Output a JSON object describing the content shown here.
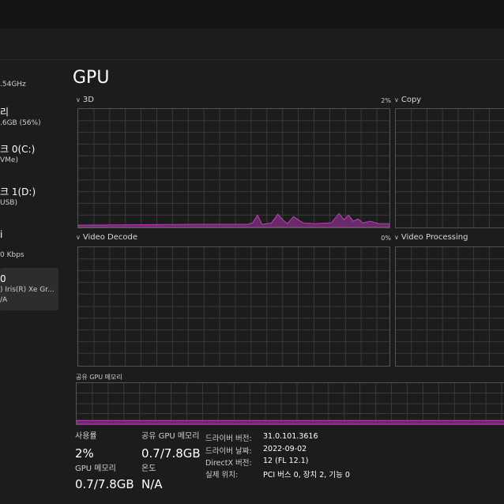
{
  "sidebar": {
    "items": [
      {
        "title": "",
        "sub": ".54GHz"
      },
      {
        "title": "리",
        "sub": ".6GB (56%)"
      },
      {
        "title": "크 0(C:)",
        "sub": "VMe)"
      },
      {
        "title": "크 1(D:)",
        "sub": "USB)"
      },
      {
        "title": "i",
        "sub": "0 Kbps"
      },
      {
        "title": "0",
        "sub": ") Iris(R) Xe Gr...",
        "sub2": "/A"
      }
    ]
  },
  "gpu": {
    "title": "GPU",
    "engines": [
      {
        "label": "3D",
        "percent": "2%"
      },
      {
        "label": "Copy",
        "percent": ""
      },
      {
        "label": "Video Decode",
        "percent": "0%"
      },
      {
        "label": "Video Processing",
        "percent": ""
      }
    ],
    "shared_memory_label": "공유 GPU 메모리",
    "accent_color": "#c040c0",
    "stats": {
      "utilization_label": "사용률",
      "utilization_value": "2%",
      "shared_memory_label": "공유 GPU 메모리",
      "shared_memory_value": "0.7/7.8GB",
      "gpu_memory_label": "GPU 메모리",
      "gpu_memory_value": "0.7/7.8GB",
      "temperature_label": "온도",
      "temperature_value": "N/A"
    },
    "info": [
      {
        "key": "드라이버 버전:",
        "value": "31.0.101.3616"
      },
      {
        "key": "드라이버 날짜:",
        "value": "2022-09-02"
      },
      {
        "key": "DirectX 버전:",
        "value": "12 (FL 12.1)"
      },
      {
        "key": "실제 위치:",
        "value": "PCI 버스 0, 장치 2, 기능 0"
      }
    ]
  }
}
